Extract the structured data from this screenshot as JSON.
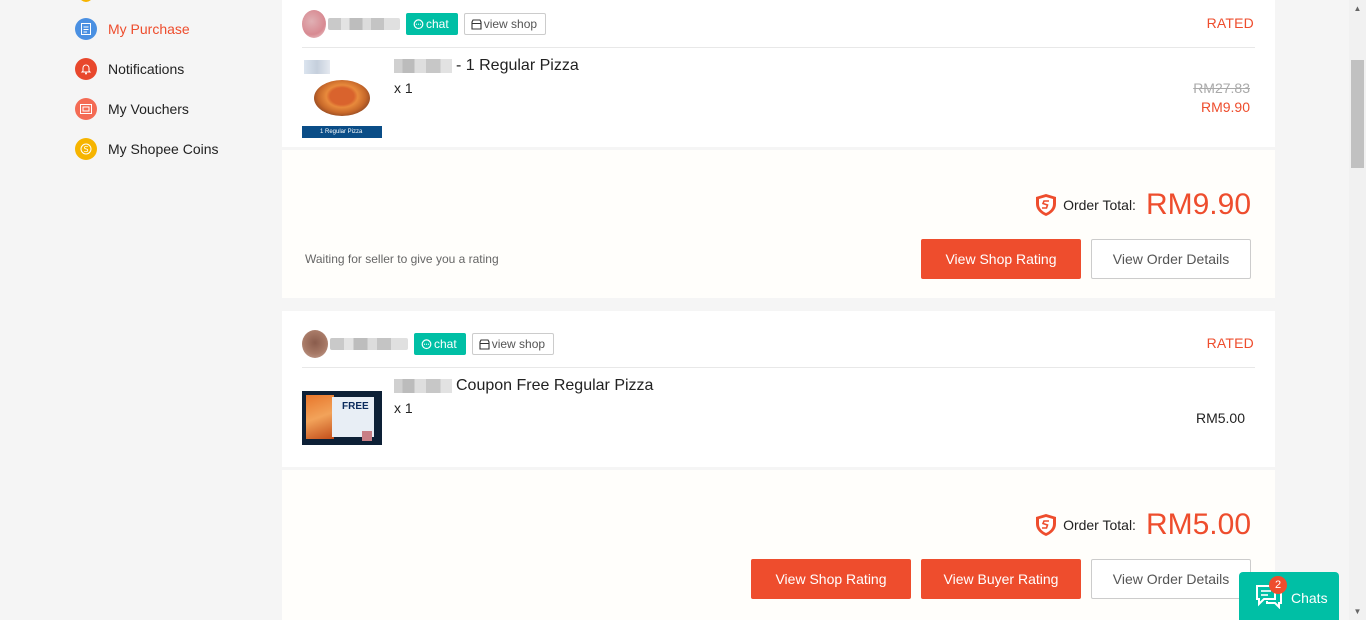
{
  "sidebar": {
    "items": [
      {
        "label": "My Purchase",
        "icon": "document-icon",
        "color": "#4a90e2",
        "active": true
      },
      {
        "label": "Notifications",
        "icon": "bell-icon",
        "color": "#ee4d2d"
      },
      {
        "label": "My Vouchers",
        "icon": "voucher-icon",
        "color": "#f46b54"
      },
      {
        "label": "My Shopee Coins",
        "icon": "coin-icon",
        "color": "#f6b400"
      }
    ]
  },
  "orders": [
    {
      "chat_label": "chat",
      "view_shop_label": "view shop",
      "status": "RATED",
      "product_name": "- 1 Regular Pizza",
      "thumb_caption": "1 Regular Pizza",
      "quantity": "x 1",
      "price_original": "RM27.83",
      "price_current": "RM9.90",
      "order_total_label": "Order Total:",
      "order_total": "RM9.90",
      "note": "Waiting for seller to give you a rating",
      "buttons": {
        "shop_rating": "View Shop Rating",
        "order_details": "View Order Details"
      }
    },
    {
      "chat_label": "chat",
      "view_shop_label": "view shop",
      "status": "RATED",
      "product_name": "Coupon Free Regular Pizza",
      "thumb_caption": "FREE",
      "quantity": "x 1",
      "price": "RM5.00",
      "order_total_label": "Order Total:",
      "order_total": "RM5.00",
      "buttons": {
        "shop_rating": "View Shop Rating",
        "buyer_rating": "View Buyer Rating",
        "order_details": "View Order Details"
      }
    }
  ],
  "chats": {
    "label": "Chats",
    "badge": "2"
  },
  "colors": {
    "accent": "#ee4d2d",
    "chat": "#00bfa5"
  }
}
